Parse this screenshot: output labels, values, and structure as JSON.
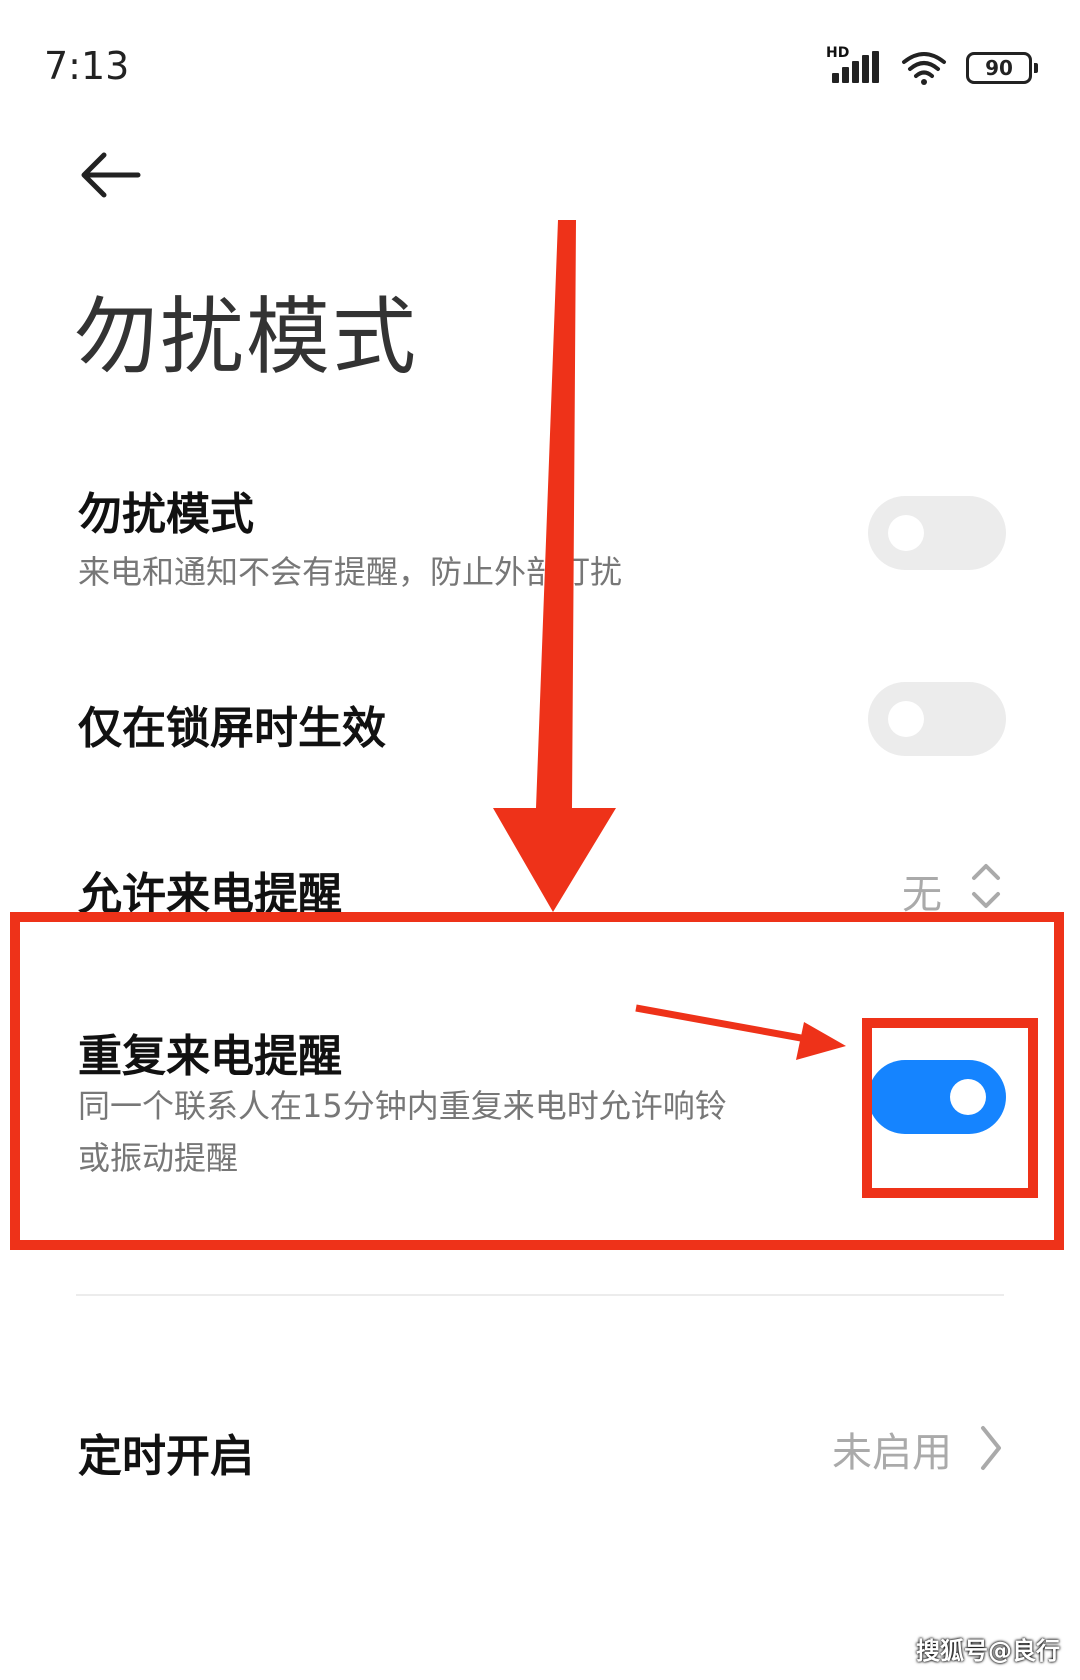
{
  "status_bar": {
    "time": "7:13",
    "signal_label": "HD",
    "battery": "90"
  },
  "header": {
    "title": "勿扰模式"
  },
  "settings": {
    "dnd": {
      "title": "勿扰模式",
      "subtitle": "来电和通知不会有提醒，防止外部打扰",
      "enabled": false
    },
    "lock_only": {
      "title": "仅在锁屏时生效",
      "enabled": false
    },
    "allow_calls": {
      "title": "允许来电提醒",
      "value": "无"
    },
    "repeat_calls": {
      "title": "重复来电提醒",
      "subtitle_line1": "同一个联系人在15分钟内重复来电时允许响铃",
      "subtitle_line2": "或振动提醒",
      "enabled": true
    },
    "schedule": {
      "title": "定时开启",
      "value": "未启用"
    }
  },
  "watermark": "搜狐号@良行",
  "colors": {
    "accent": "#1584ff",
    "annotation": "#ee3219",
    "toggle_off": "#ececec"
  },
  "icons": {
    "back": "arrow-left-icon",
    "updown": "chevron-updown-icon",
    "right": "chevron-right-icon"
  }
}
